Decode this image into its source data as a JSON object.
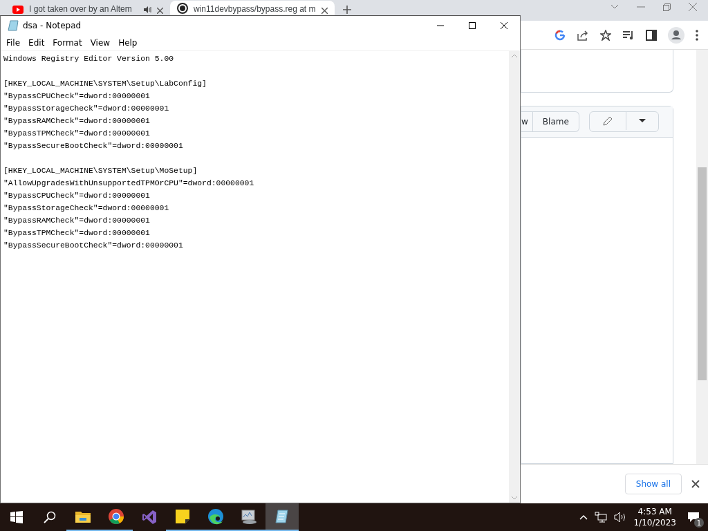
{
  "browser": {
    "tabs": [
      {
        "title": "I got taken over by an Altem",
        "selected": false,
        "audio": true
      },
      {
        "title": "win11devbypass/bypass.reg at m",
        "selected": true,
        "audio": false
      }
    ],
    "file_actions": [
      "w",
      "Blame"
    ],
    "download_bar": {
      "button": "Show all"
    }
  },
  "notepad": {
    "title": "dsa - Notepad",
    "menu": [
      "File",
      "Edit",
      "Format",
      "View",
      "Help"
    ],
    "blocks": [
      [
        "Windows Registry Editor Version 5.00"
      ],
      [
        "[HKEY_LOCAL_MACHINE\\SYSTEM\\Setup\\LabConfig]",
        "\"BypassCPUCheck\"=dword:00000001",
        "\"BypassStorageCheck\"=dword:00000001",
        "\"BypassRAMCheck\"=dword:00000001",
        "\"BypassTPMCheck\"=dword:00000001",
        "\"BypassSecureBootCheck\"=dword:00000001"
      ],
      [
        "[HKEY_LOCAL_MACHINE\\SYSTEM\\Setup\\MoSetup]",
        "\"AllowUpgradesWithUnsupportedTPMOrCPU\"=dword:00000001",
        "\"BypassCPUCheck\"=dword:00000001",
        "\"BypassStorageCheck\"=dword:00000001",
        "\"BypassRAMCheck\"=dword:00000001",
        "\"BypassTPMCheck\"=dword:00000001",
        "\"BypassSecureBootCheck\"=dword:00000001"
      ]
    ]
  },
  "taskbar": {
    "apps": [
      {
        "kind": "explorer",
        "running": true,
        "active": false
      },
      {
        "kind": "chrome",
        "running": true,
        "active": false
      },
      {
        "kind": "studio",
        "running": false,
        "active": false
      },
      {
        "kind": "notes",
        "running": true,
        "active": false
      },
      {
        "kind": "edge",
        "running": true,
        "active": false
      },
      {
        "kind": "monitor",
        "running": true,
        "active": false
      },
      {
        "kind": "notepad",
        "running": true,
        "active": true
      }
    ],
    "time": "4:53 AM",
    "date": "1/10/2023",
    "notifications": "1"
  }
}
